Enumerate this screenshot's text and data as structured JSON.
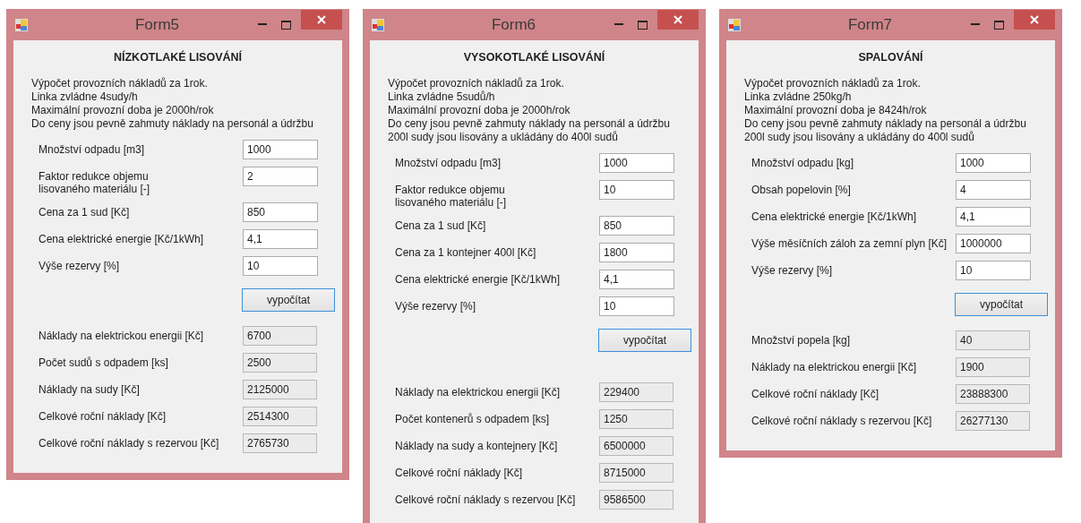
{
  "windows": [
    {
      "title": "Form5",
      "heading": "NÍZKOTLAKÉ LISOVÁNÍ",
      "description": [
        "Výpočet provozních nákladů za 1rok.",
        "Linka zvládne 4sudy/h",
        "Maximální provozní doba je 2000h/rok",
        "Do ceny jsou pevně zahmuty náklady na personál a údržbu"
      ],
      "inputs": [
        {
          "label": "Množství odpadu [m3]",
          "value": "1000"
        },
        {
          "label": "Faktor redukce objemu\nlisovaného materiálu [-]",
          "value": "2"
        },
        {
          "label": "Cena za 1 sud [Kč]",
          "value": "850"
        },
        {
          "label": "Cena elektrické energie [Kč/1kWh]",
          "value": "4,1"
        },
        {
          "label": "Výše rezervy [%]",
          "value": "10"
        }
      ],
      "button": "vypočítat",
      "outputs": [
        {
          "label": "Náklady na elektrickou energii [Kč]",
          "value": "6700"
        },
        {
          "label": "Počet sudů s odpadem [ks]",
          "value": "2500"
        },
        {
          "label": "Náklady na sudy [Kč]",
          "value": "2125000"
        },
        {
          "label": "Celkové roční náklady [Kč]",
          "value": "2514300"
        },
        {
          "label": "Celkové roční náklady s rezervou [Kč]",
          "value": "2765730"
        }
      ]
    },
    {
      "title": "Form6",
      "heading": "VYSOKOTLAKÉ LISOVÁNÍ",
      "description": [
        "Výpočet provozních nákladů za 1rok.",
        "Linka zvládne 5sudů/h",
        "Maximální provozní doba je 2000h/rok",
        "Do ceny jsou pevně zahmuty náklady na personál a údržbu",
        "200l sudy jsou lisovány a ukládány do 400l sudů"
      ],
      "inputs": [
        {
          "label": "Množství odpadu [m3]",
          "value": "1000"
        },
        {
          "label": "Faktor redukce objemu\nlisovaného materiálu [-]",
          "value": "10"
        },
        {
          "label": "Cena za 1 sud [Kč]",
          "value": "850"
        },
        {
          "label": "Cena za 1 kontejner 400l [Kč]",
          "value": "1800"
        },
        {
          "label": "Cena elektrické energie [Kč/1kWh]",
          "value": "4,1"
        },
        {
          "label": "Výše rezervy [%]",
          "value": "10"
        }
      ],
      "button": "vypočítat",
      "outputs": [
        {
          "label": "Náklady na elektrickou energii [Kč]",
          "value": "229400"
        },
        {
          "label": "Počet kontenerů s odpadem [ks]",
          "value": "1250"
        },
        {
          "label": "Náklady na sudy a kontejnery [Kč]",
          "value": "6500000"
        },
        {
          "label": "Celkové roční náklady [Kč]",
          "value": "8715000"
        },
        {
          "label": "Celkové roční náklady s rezervou [Kč]",
          "value": "9586500"
        }
      ]
    },
    {
      "title": "Form7",
      "heading": "SPALOVÁNÍ",
      "description": [
        "Výpočet provozních nákladů za 1rok.",
        "Linka zvládne 250kg/h",
        "Maximální provozní doba je 8424h/rok",
        "Do ceny jsou pevně zahmuty náklady na personál a údržbu",
        "200l sudy jsou lisovány a ukládány do 400l sudů"
      ],
      "inputs": [
        {
          "label": "Množství odpadu [kg]",
          "value": "1000"
        },
        {
          "label": "Obsah popelovin [%]",
          "value": "4"
        },
        {
          "label": "Cena elektrické energie [Kč/1kWh]",
          "value": "4,1"
        },
        {
          "label": "Výše měsíčních záloh za zemní plyn [Kč]",
          "value": "1000000"
        },
        {
          "label": "Výše rezervy [%]",
          "value": "10"
        }
      ],
      "button": "vypočítat",
      "outputs": [
        {
          "label": "Množství popela [kg]",
          "value": "40"
        },
        {
          "label": "Náklady na elektrickou energii [Kč]",
          "value": "1900"
        },
        {
          "label": "Celkové roční náklady [Kč]",
          "value": "23888300"
        },
        {
          "label": "Celkové roční náklady s rezervou [Kč]",
          "value": "26277130"
        }
      ]
    }
  ]
}
